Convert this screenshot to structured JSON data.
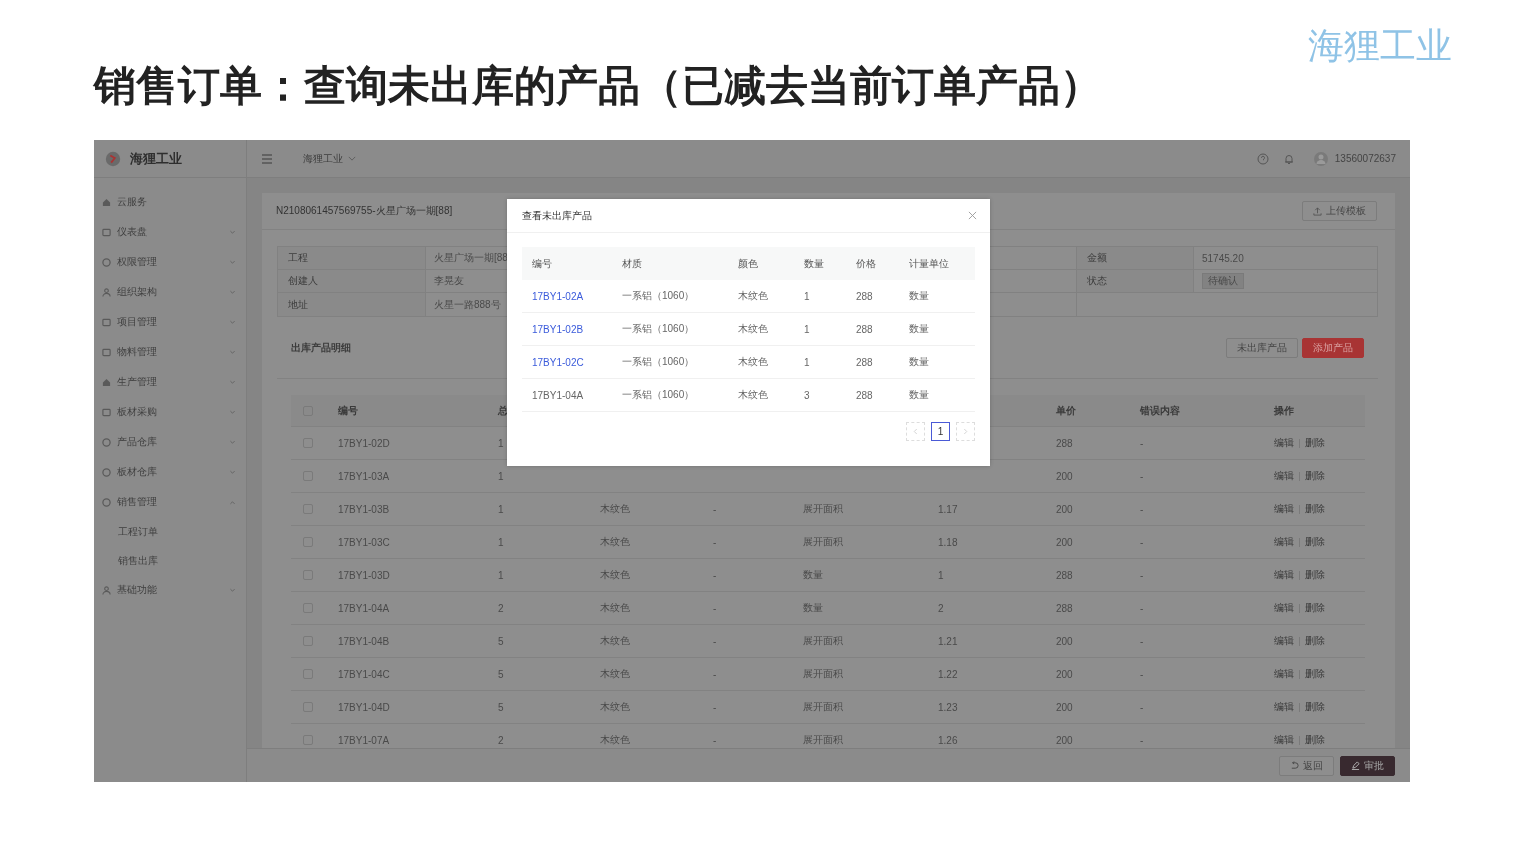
{
  "slide": {
    "title": "销售订单：查询未出库的产品（已减去当前订单产品）",
    "brand": "海狸工业"
  },
  "sidebar": {
    "brand": "海狸工业",
    "items": [
      {
        "label": "云服务",
        "kind": "link"
      },
      {
        "label": "仪表盘",
        "kind": "group",
        "expanded": false
      },
      {
        "label": "权限管理",
        "kind": "group",
        "expanded": false
      },
      {
        "label": "组织架构",
        "kind": "group",
        "expanded": false
      },
      {
        "label": "项目管理",
        "kind": "group",
        "expanded": false
      },
      {
        "label": "物料管理",
        "kind": "group",
        "expanded": false
      },
      {
        "label": "生产管理",
        "kind": "group",
        "expanded": false
      },
      {
        "label": "板材采购",
        "kind": "group",
        "expanded": false
      },
      {
        "label": "产品仓库",
        "kind": "group",
        "expanded": false
      },
      {
        "label": "板材仓库",
        "kind": "group",
        "expanded": false
      },
      {
        "label": "销售管理",
        "kind": "group",
        "expanded": true,
        "children": [
          {
            "label": "工程订单"
          },
          {
            "label": "销售出库"
          }
        ]
      },
      {
        "label": "基础功能",
        "kind": "group",
        "expanded": false
      }
    ]
  },
  "topbar": {
    "org": "海狸工业",
    "user": "13560072637"
  },
  "order": {
    "title": "N2108061457569755-火星广场一期[88]",
    "upload_button": "上传模板",
    "info_left": [
      {
        "label": "工程",
        "value": "火星广场一期[88"
      },
      {
        "label": "创建人",
        "value": "李晃友"
      },
      {
        "label": "地址",
        "value": "火星一路888号"
      }
    ],
    "info_right": [
      {
        "label": "金额",
        "value": "51745.20",
        "kind": "text"
      },
      {
        "label": "状态",
        "value": "待确认",
        "kind": "tag"
      }
    ]
  },
  "details": {
    "title": "出库产品明细",
    "buttons": [
      {
        "label": "未出库产品",
        "kind": "default"
      },
      {
        "label": "添加产品",
        "kind": "primary"
      }
    ],
    "all_checked": false,
    "columns": [
      "编号",
      "总",
      null,
      null,
      null,
      null,
      "单价",
      "错误内容",
      "操作"
    ],
    "rows": [
      {
        "checked": false,
        "cells": [
          "17BY1-02D",
          "1",
          null,
          null,
          null,
          null,
          "288",
          "-"
        ],
        "actions": [
          "编辑",
          "删除"
        ]
      },
      {
        "checked": false,
        "cells": [
          "17BY1-03A",
          "1",
          null,
          null,
          null,
          null,
          "200",
          "-"
        ],
        "actions": [
          "编辑",
          "删除"
        ]
      },
      {
        "checked": false,
        "cells": [
          "17BY1-03B",
          "1",
          "木纹色",
          "-",
          "展开面积",
          "1.17",
          "200",
          "-"
        ],
        "actions": [
          "编辑",
          "删除"
        ]
      },
      {
        "checked": false,
        "cells": [
          "17BY1-03C",
          "1",
          "木纹色",
          "-",
          "展开面积",
          "1.18",
          "200",
          "-"
        ],
        "actions": [
          "编辑",
          "删除"
        ]
      },
      {
        "checked": false,
        "cells": [
          "17BY1-03D",
          "1",
          "木纹色",
          "-",
          "数量",
          "1",
          "288",
          "-"
        ],
        "actions": [
          "编辑",
          "删除"
        ]
      },
      {
        "checked": false,
        "cells": [
          "17BY1-04A",
          "2",
          "木纹色",
          "-",
          "数量",
          "2",
          "288",
          "-"
        ],
        "actions": [
          "编辑",
          "删除"
        ]
      },
      {
        "checked": false,
        "cells": [
          "17BY1-04B",
          "5",
          "木纹色",
          "-",
          "展开面积",
          "1.21",
          "200",
          "-"
        ],
        "actions": [
          "编辑",
          "删除"
        ]
      },
      {
        "checked": false,
        "cells": [
          "17BY1-04C",
          "5",
          "木纹色",
          "-",
          "展开面积",
          "1.22",
          "200",
          "-"
        ],
        "actions": [
          "编辑",
          "删除"
        ]
      },
      {
        "checked": false,
        "cells": [
          "17BY1-04D",
          "5",
          "木纹色",
          "-",
          "展开面积",
          "1.23",
          "200",
          "-"
        ],
        "actions": [
          "编辑",
          "删除"
        ]
      },
      {
        "checked": false,
        "cells": [
          "17BY1-07A",
          "2",
          "木纹色",
          "-",
          "展开面积",
          "1.26",
          "200",
          "-"
        ],
        "actions": [
          "编辑",
          "删除"
        ]
      }
    ]
  },
  "footer": {
    "back_button": "返回",
    "approve_button": "审批"
  },
  "modal": {
    "title": "查看未出库产品",
    "columns": [
      "编号",
      "材质",
      "颜色",
      "数量",
      "价格",
      "计量单位"
    ],
    "rows": [
      {
        "linked": true,
        "cells": [
          "17BY1-02A",
          "一系铝（1060）",
          "木纹色",
          "1",
          "288",
          "数量"
        ]
      },
      {
        "linked": true,
        "cells": [
          "17BY1-02B",
          "一系铝（1060）",
          "木纹色",
          "1",
          "288",
          "数量"
        ]
      },
      {
        "linked": true,
        "cells": [
          "17BY1-02C",
          "一系铝（1060）",
          "木纹色",
          "1",
          "288",
          "数量"
        ]
      },
      {
        "linked": false,
        "cells": [
          "17BY1-04A",
          "一系铝（1060）",
          "木纹色",
          "3",
          "288",
          "数量"
        ]
      }
    ],
    "pages": [
      {
        "label": "1",
        "selected": true
      }
    ]
  }
}
